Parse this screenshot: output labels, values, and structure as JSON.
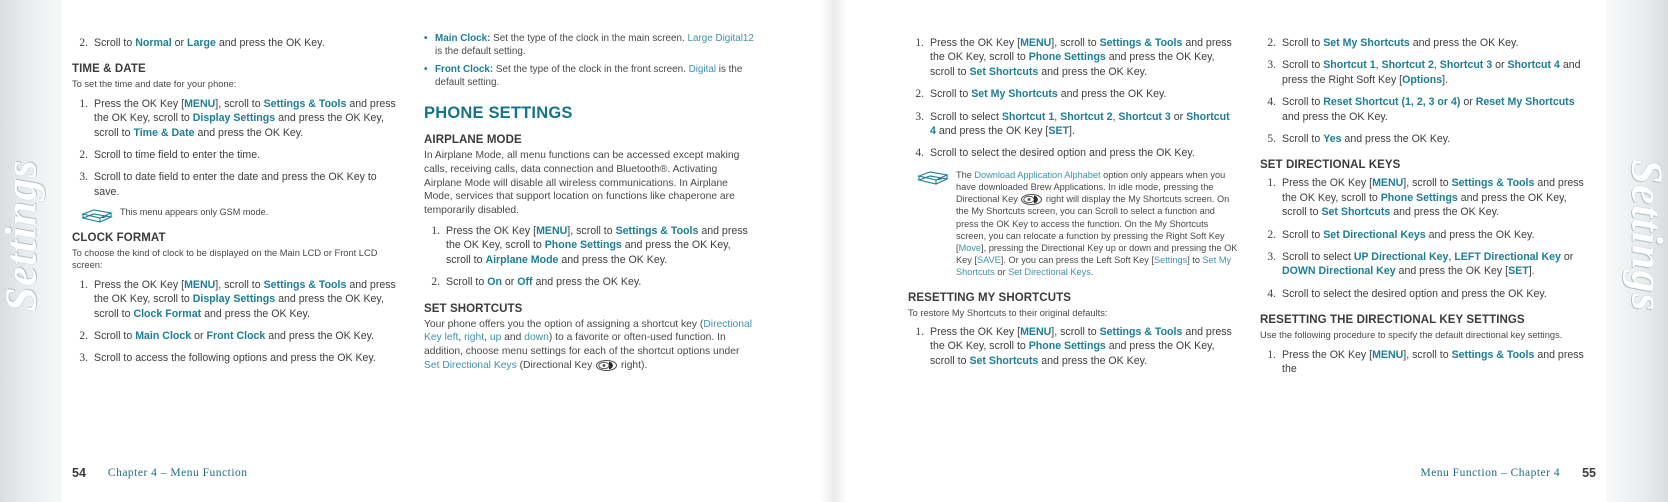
{
  "book": {
    "edge_tab_label": "Settings",
    "accent_color": "#1d7e96",
    "link_color": "#3f93a8",
    "body_color": "#4a4a4a"
  },
  "left_page": {
    "number": "54",
    "footer_text": "Chapter 4 – Menu Function",
    "column1": {
      "step2_clockstyle": {
        "num": "2.",
        "parts": [
          "Scroll to ",
          "Normal",
          " or ",
          "Large",
          " and press the OK Key."
        ]
      },
      "time_date": {
        "heading": "TIME & DATE",
        "intro": "To set the time and date for your phone:",
        "steps": [
          {
            "num": "1.",
            "parts": [
              "Press the OK Key [",
              "MENU",
              "], scroll to ",
              "Settings & Tools",
              " and press the OK Key, scroll to ",
              "Display Settings",
              " and press the OK Key, scroll to ",
              "Time & Date",
              " and press the OK Key."
            ]
          },
          {
            "num": "2.",
            "parts": [
              "Scroll to time field to enter the time."
            ]
          },
          {
            "num": "3.",
            "parts": [
              "Scroll to date field to enter the date and press the OK Key to save."
            ]
          }
        ],
        "note": "This menu appears only GSM mode."
      },
      "clock_format": {
        "heading": "CLOCK FORMAT",
        "intro": "To choose the kind of clock to be displayed on the Main LCD or Front LCD screen:",
        "steps": [
          {
            "num": "1.",
            "parts": [
              "Press the OK Key [",
              "MENU",
              "], scroll to ",
              "Settings & Tools",
              " and press the OK Key, scroll to ",
              "Display Settings",
              " and press the OK Key, scroll to ",
              "Clock Format",
              " and press the OK Key."
            ]
          },
          {
            "num": "2.",
            "parts": [
              "Scroll to ",
              "Main Clock",
              " or ",
              "Front Clock",
              " and press the OK Key."
            ]
          },
          {
            "num": "3.",
            "parts": [
              "Scroll to access the following options and press the OK Key."
            ]
          }
        ]
      }
    },
    "column2": {
      "bullets": [
        {
          "term": "Main Clock:",
          "text_before": " Set the type of the clock in the main screen. ",
          "link": "Large Digital12",
          "text_after": " is the default setting."
        },
        {
          "term": "Front Clock:",
          "text_before": " Set the type of the clock in the front screen. ",
          "link": "Digital",
          "text_after": " is the default setting."
        }
      ],
      "phone_settings_heading": "PHONE SETTINGS",
      "airplane_mode": {
        "heading": "AIRPLANE MODE",
        "paragraph": "In Airplane Mode, all menu functions can be accessed except making calls, receiving calls, data connection and Bluetooth®. Activating Airplane Mode will disable all wireless communications. In Airplane Mode, services that support location on functions like chaperone are temporarily disabled.",
        "steps": [
          {
            "num": "1.",
            "parts": [
              "Press the OK Key [",
              "MENU",
              "], scroll to ",
              "Settings & Tools",
              " and press the OK Key, scroll to ",
              "Phone Settings",
              " and press the OK Key, scroll to ",
              "Airplane Mode",
              " and press the OK Key."
            ]
          },
          {
            "num": "2.",
            "parts": [
              "Scroll to ",
              "On",
              " or ",
              "Off",
              " and press the OK Key."
            ]
          }
        ]
      },
      "set_shortcuts": {
        "heading": "SET SHORTCUTS",
        "paragraph_p1": "Your phone offers you the option of assigning a shortcut key (",
        "link1": "Directional Key left",
        "sep1": ", ",
        "link2": "right",
        "sep2": ", ",
        "link3": "up",
        "sep3": " and ",
        "link4": "down",
        "paragraph_p2": ") to a favorite or often-used function. In addition, choose menu settings for each of the shortcut options under ",
        "link5": "Set Directional Keys",
        "paragraph_p3": " (Directional Key ",
        "paragraph_p4": " right)."
      }
    }
  },
  "right_page": {
    "number": "55",
    "footer_text": "Menu Function – Chapter 4",
    "column3": {
      "steps": [
        {
          "num": "1.",
          "parts": [
            "Press the OK Key [",
            "MENU",
            "], scroll to ",
            "Settings & Tools",
            " and press the OK Key, scroll to ",
            "Phone Settings",
            " and press the OK Key, scroll to ",
            "Set Shortcuts",
            " and press the OK Key."
          ]
        },
        {
          "num": "2.",
          "parts": [
            "Scroll to ",
            "Set My Shortcuts",
            " and press the OK Key."
          ]
        },
        {
          "num": "3.",
          "parts": [
            "Scroll to select ",
            "Shortcut 1",
            ", ",
            "Shortcut 2",
            ", ",
            "Shortcut 3",
            " or ",
            "Shortcut 4",
            " and press the OK Key [",
            "SET",
            "]."
          ]
        },
        {
          "num": "4.",
          "parts": [
            "Scroll to select the desired option and press the OK Key."
          ]
        }
      ],
      "note": {
        "p1": "The ",
        "link1": "Download Application Alphabet",
        "p2": " option only appears when you have downloaded Brew Applications. In idle mode, pressing the Directional Key ",
        "p3": " right will display the My Shortcuts screen. On the My Shortcuts screen, you can Scroll to select a function and press the OK Key to access the function. On the My Shortcuts screen, you can relocate a function by pressing the Right Soft Key [",
        "link2": "Move",
        "p4": "], pressing the Directional Key up or down and pressing the OK Key [",
        "link3": "SAVE",
        "p5": "]. Or you can press the Left Soft Key [",
        "link4": "Settings",
        "p6": "] to ",
        "link5": "Set My Shortcuts",
        "p7": " or ",
        "link6": "Set Directional Keys",
        "p8": "."
      },
      "resetting": {
        "heading": "RESETTING MY SHORTCUTS",
        "intro": "To restore My Shortcuts to their original defaults:",
        "steps": [
          {
            "num": "1.",
            "parts": [
              "Press the OK Key [",
              "MENU",
              "], scroll to ",
              "Settings & Tools",
              " and press the OK Key, scroll to ",
              "Phone Settings",
              " and press the OK Key, scroll to ",
              "Set Shortcuts",
              " and press the OK Key."
            ]
          }
        ]
      }
    },
    "column4": {
      "steps_top": [
        {
          "num": "2.",
          "parts": [
            "Scroll to ",
            "Set My Shortcuts",
            " and press the OK Key."
          ]
        },
        {
          "num": "3.",
          "parts": [
            "Scroll to ",
            "Shortcut 1",
            ", ",
            "Shortcut 2",
            ", ",
            "Shortcut 3",
            " or ",
            "Shortcut 4",
            " and press the Right Soft Key [",
            "Options",
            "]."
          ]
        },
        {
          "num": "4.",
          "parts": [
            "Scroll to ",
            "Reset Shortcut (1, 2, 3 or 4)",
            " or ",
            "Reset My Shortcuts",
            " and press the OK Key."
          ]
        },
        {
          "num": "5.",
          "parts": [
            "Scroll to ",
            "Yes",
            " and press the OK Key."
          ]
        }
      ],
      "set_directional_keys": {
        "heading": "SET DIRECTIONAL KEYS",
        "steps": [
          {
            "num": "1.",
            "parts": [
              "Press the OK Key [",
              "MENU",
              "], scroll to ",
              "Settings & Tools",
              " and press the OK Key, scroll to ",
              "Phone Settings",
              " and press the OK Key, scroll to ",
              "Set Shortcuts",
              " and press the OK Key."
            ]
          },
          {
            "num": "2.",
            "parts": [
              "Scroll to ",
              "Set Directional Keys",
              " and press the OK Key."
            ]
          },
          {
            "num": "3.",
            "parts": [
              "Scroll to select ",
              "UP Directional Key",
              ", ",
              "LEFT Directional Key",
              " or ",
              "DOWN Directional Key",
              " and press the OK Key [",
              "SET",
              "]."
            ]
          },
          {
            "num": "4.",
            "parts": [
              "Scroll to select the desired option and press the OK Key."
            ]
          }
        ]
      },
      "resetting_dir": {
        "heading": "RESETTING THE DIRECTIONAL KEY SETTINGS",
        "intro": "Use the following procedure to specify the default directional key settings.",
        "steps": [
          {
            "num": "1.",
            "parts": [
              "Press the OK Key [",
              "MENU",
              "], scroll to ",
              "Settings & Tools",
              " and press the"
            ]
          }
        ]
      }
    }
  }
}
